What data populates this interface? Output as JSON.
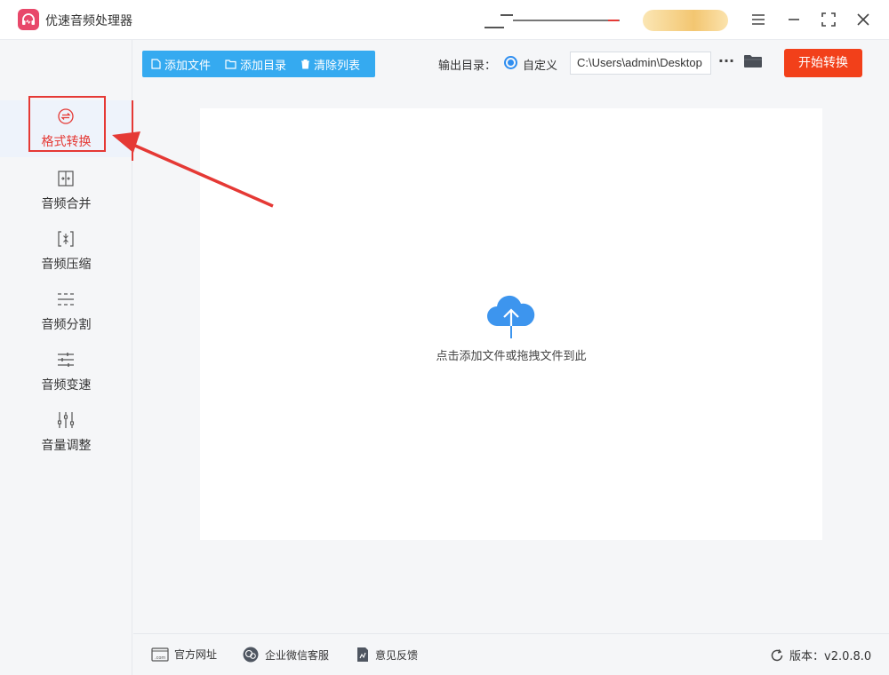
{
  "app": {
    "title": "优速音频处理器",
    "accent": "#e8486a"
  },
  "window_controls": [
    "menu-icon",
    "minimize-icon",
    "maximize-icon",
    "close-icon"
  ],
  "sidebar": {
    "items": [
      {
        "label": "格式转换",
        "icon": "format-convert-icon",
        "active": true
      },
      {
        "label": "音频合并",
        "icon": "merge-icon"
      },
      {
        "label": "音频压缩",
        "icon": "compress-icon"
      },
      {
        "label": "音频分割",
        "icon": "split-icon"
      },
      {
        "label": "音频变速",
        "icon": "speed-icon"
      },
      {
        "label": "音量调整",
        "icon": "volume-icon"
      }
    ],
    "active_color": "#e53935"
  },
  "toolbar": {
    "add_file": "添加文件",
    "add_folder": "添加目录",
    "clear_list": "清除列表",
    "color": "#35aaf0"
  },
  "output": {
    "label": "输出目录：",
    "option": "自定义",
    "path": "C:\\Users\\admin\\Desktop",
    "more": "···",
    "start_label": "开始转换",
    "start_color": "#f2401a"
  },
  "dropzone": {
    "text": "点击添加文件或拖拽文件到此",
    "icon": "cloud-upload-icon"
  },
  "footer": {
    "website": "官方网址",
    "wechat": "企业微信客服",
    "feedback": "意见反馈",
    "version": "版本：v2.0.8.0"
  }
}
